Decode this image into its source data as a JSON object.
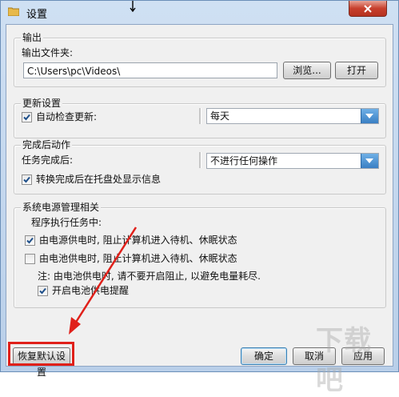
{
  "window": {
    "title": "设置"
  },
  "output": {
    "legend": "输出",
    "folder_label": "输出文件夹:",
    "folder_value": "C:\\Users\\pc\\Videos\\",
    "browse_label": "浏览...",
    "open_label": "打开"
  },
  "update": {
    "legend": "更新设置",
    "auto_check_label": "自动检查更新:",
    "auto_check_checked": true,
    "frequency_value": "每天"
  },
  "after": {
    "legend": "完成后动作",
    "task_done_label": "任务完成后:",
    "action_value": "不进行任何操作",
    "tray_label": "转换完成后在托盘处显示信息",
    "tray_checked": true
  },
  "power": {
    "legend": "系统电源管理相关",
    "running_label": "程序执行任务中:",
    "ac_label": "由电源供电时, 阻止计算机进入待机、休眠状态",
    "ac_checked": true,
    "battery_label": "由电池供电时, 阻止计算机进入待机、休眠状态",
    "battery_checked": false,
    "note": "注: 由电池供电时, 请不要开启阻止, 以避免电量耗尽.",
    "reminder_label": "开启电池供电提醒",
    "reminder_checked": true
  },
  "footer": {
    "restore_label": "恢复默认设置",
    "ok_label": "确定",
    "cancel_label": "取消",
    "apply_label": "应用"
  },
  "watermark": "下载吧",
  "colors": {
    "highlight": "#e0201a",
    "dropdown_accent": "#3a7fc4"
  }
}
